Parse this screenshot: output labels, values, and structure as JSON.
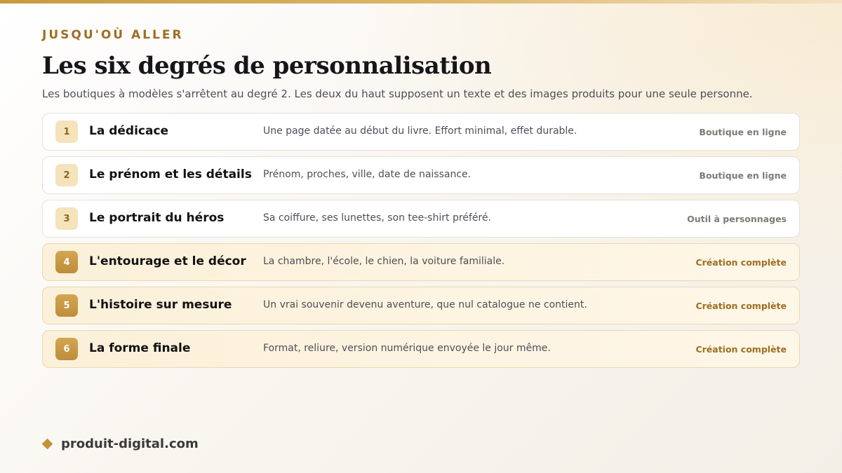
{
  "header": {
    "eyebrow": "JUSQU'OÙ ALLER",
    "title": "Les six degrés de personnalisation",
    "subtitle": "Les boutiques à modèles s'arrêtent au degré 2. Les deux du haut supposent un texte et des images produits pour une seule personne."
  },
  "degrees": [
    {
      "number": "1",
      "name": "La dédicace",
      "description": "Une page datée au début du livre. Effort minimal, effet durable.",
      "tag": "Boutique en ligne"
    },
    {
      "number": "2",
      "name": "Le prénom et les détails",
      "description": "Prénom, proches, ville, date de naissance.",
      "tag": "Boutique en ligne"
    },
    {
      "number": "3",
      "name": "Le portrait du héros",
      "description": "Sa coiffure, ses lunettes, son tee-shirt préféré.",
      "tag": "Outil à personnages"
    },
    {
      "number": "4",
      "name": "L'entourage et le décor",
      "description": "La chambre, l'école, le chien, la voiture familiale.",
      "tag": "Création complète"
    },
    {
      "number": "5",
      "name": "L'histoire sur mesure",
      "description": "Un vrai souvenir devenu aventure, que nul catalogue ne contient.",
      "tag": "Création complète"
    },
    {
      "number": "6",
      "name": "La forme finale",
      "description": "Format, reliure, version numérique envoyée le jour même.",
      "tag": "Création complète"
    }
  ],
  "footer": {
    "icon": "diamond-icon",
    "brand": "produit-digital.com"
  },
  "colors": {
    "accent": "#c69a3e",
    "accent_dark": "#9c6f22",
    "highlight_row_bg": "#fbf0d9"
  }
}
